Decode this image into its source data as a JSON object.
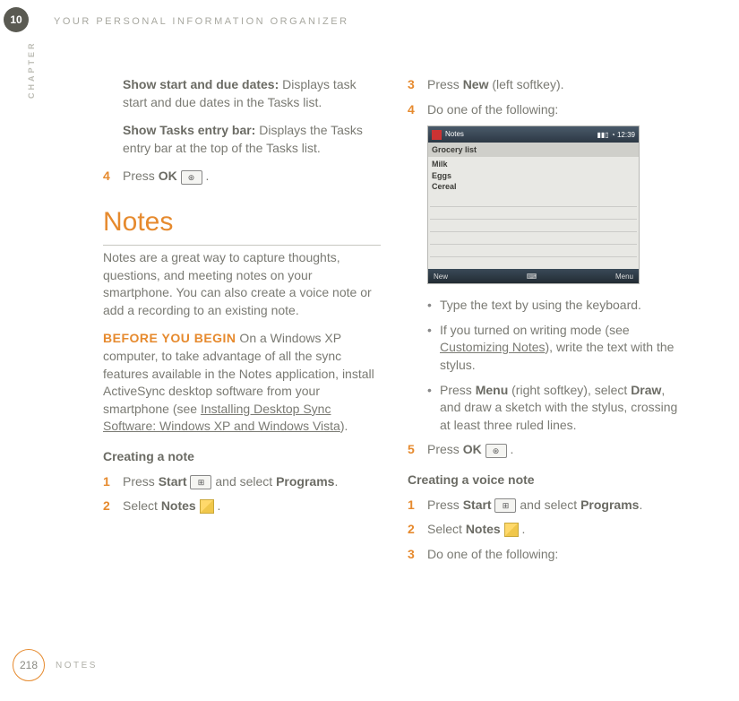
{
  "header": {
    "chapter_num": "10",
    "chapter_label": "CHAPTER",
    "running_head": "YOUR PERSONAL INFORMATION ORGANIZER"
  },
  "left": {
    "show_dates_label": "Show start and due dates:",
    "show_dates_text": " Displays task start and due dates in the Tasks list.",
    "show_tasks_label": "Show Tasks entry bar:",
    "show_tasks_text": " Displays the Tasks entry bar at the top of the Tasks list.",
    "step4_num": "4",
    "step4_press": "Press ",
    "step4_ok": "OK",
    "section_title": "Notes",
    "notes_intro": "Notes are a great way to capture thoughts, questions, and meeting notes on your smartphone. You can also create a voice note or add a recording to an existing note.",
    "before_label": "BEFORE YOU BEGIN",
    "before_text_a": "  On a Windows XP computer, to take advantage of all the sync features available in the Notes application, install ActiveSync desktop software from your smartphone (see ",
    "before_link": "Installing Desktop Sync Software: Windows XP and Windows Vista",
    "before_text_b": ").",
    "subhead_create": "Creating a note",
    "s1_num": "1",
    "s1_press": "Press ",
    "s1_start": "Start",
    "s1_select": " and select ",
    "s1_programs": "Programs",
    "s2_num": "2",
    "s2_select": "Select ",
    "s2_notes": "Notes"
  },
  "right": {
    "s3_num": "3",
    "s3_press": "Press ",
    "s3_new": "New",
    "s3_tail": " (left softkey).",
    "s4_num": "4",
    "s4_text": "Do one of the following:",
    "ss": {
      "top_left_icon": "✿",
      "top_title": "Notes",
      "top_signal": "▮▮▯  ◔ 12:39",
      "title_row": "Grocery list",
      "line1": "Milk",
      "line2": "Eggs",
      "line3": "Cereal",
      "bottom_left": "New",
      "bottom_mid": "⌨",
      "bottom_right": "Menu"
    },
    "b1": "Type the text by using the keyboard.",
    "b2a": "If you turned on writing mode (see ",
    "b2link": "Customizing Notes",
    "b2b": "), write the text with the stylus.",
    "b3a": "Press ",
    "b3menu": "Menu",
    "b3b": " (right softkey), select ",
    "b3draw": "Draw",
    "b3c": ", and draw a sketch with the stylus, crossing at least three ruled lines.",
    "s5_num": "5",
    "s5_press": "Press ",
    "s5_ok": "OK",
    "subhead_voice": "Creating a voice note",
    "v1_num": "1",
    "v1_press": "Press ",
    "v1_start": "Start",
    "v1_select": " and select ",
    "v1_programs": "Programs",
    "v2_num": "2",
    "v2_select": "Select ",
    "v2_notes": "Notes",
    "v3_num": "3",
    "v3_text": "Do one of the following:"
  },
  "footer": {
    "page": "218",
    "label": "NOTES"
  },
  "icons": {
    "ok": "⊛",
    "start": "⊞"
  }
}
